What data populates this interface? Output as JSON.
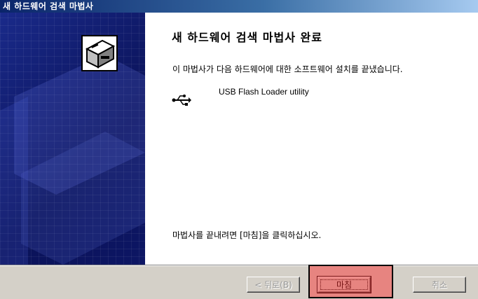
{
  "window": {
    "title": "새 하드웨어 검색 마법사"
  },
  "wizard": {
    "heading": "새 하드웨어 검색 마법사 완료",
    "description": "이 마법사가 다음 하드웨어에 대한 소프트웨어 설치를 끝냈습니다.",
    "device_name": "USB Flash Loader utility",
    "device_icon": "usb-icon",
    "hardware_icon": "hardware-wizard-icon",
    "finish_message": "마법사를 끝내려면 [마침]을 클릭하십시오."
  },
  "buttons": {
    "back_label": "< 뒤로(B)",
    "finish_label": "마침",
    "cancel_label": "취소"
  },
  "colors": {
    "titlebar": "#0a246a",
    "side_panel": "#0f1a6e",
    "button_face": "#d4d0c8",
    "highlight": "#ff2828"
  }
}
